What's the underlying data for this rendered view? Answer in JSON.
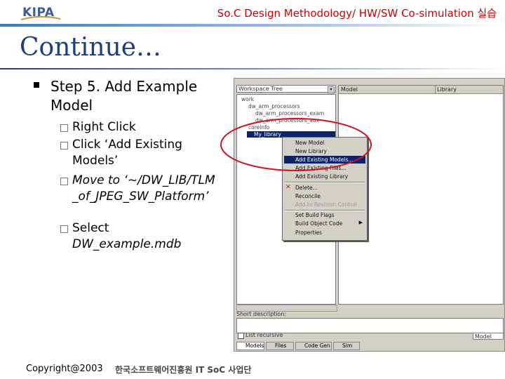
{
  "header": {
    "title": "So.C Design Methodology/ HW/SW Co-simulation 실습",
    "logo": "KIPA"
  },
  "slide": {
    "title": "Continue…",
    "step": "Step 5. Add Example Model",
    "bullets": [
      {
        "text": "Right Click",
        "italic": false
      },
      {
        "text": "Click ‘Add Existing Models’",
        "italic": false
      },
      {
        "text": "Move to ‘~/DW_LIB/TLM_of_JPEG_SW_Platform’",
        "italic": true
      },
      {
        "text": "Select DW_example.mdb",
        "prefix": "Select",
        "value": "DW_example.mdb",
        "italic": true
      }
    ]
  },
  "screenshot": {
    "workspace_label": "Workspace Tree",
    "model_col": "Model",
    "library_col": "Library",
    "tree": [
      "work",
      "dw_arm_processors",
      "dw_arm_processors_exam",
      "dw_arm_processors_aux",
      "coreinfo",
      "My_library"
    ],
    "short_description": "Short description:",
    "list_recursive": "List recursive",
    "model_placeholder": "Model",
    "tabs": [
      "Models",
      "Files",
      "Code Gen",
      "Sim"
    ],
    "context_menu": [
      "New Model",
      "New Library",
      "Add Existing Models...",
      "Add Existing Files...",
      "Add Existing Library",
      "Delete...",
      "Reconcile",
      "Add to Revision Control",
      "Set Build Flags",
      "Build Object Code",
      "Properties"
    ],
    "highlight_color": "#0a246a",
    "annotation_color": "#d0141e"
  },
  "footer": {
    "copyright": "Copyright@2003",
    "org": "한국소프트웨어진흥원 IT SoC 사업단"
  }
}
